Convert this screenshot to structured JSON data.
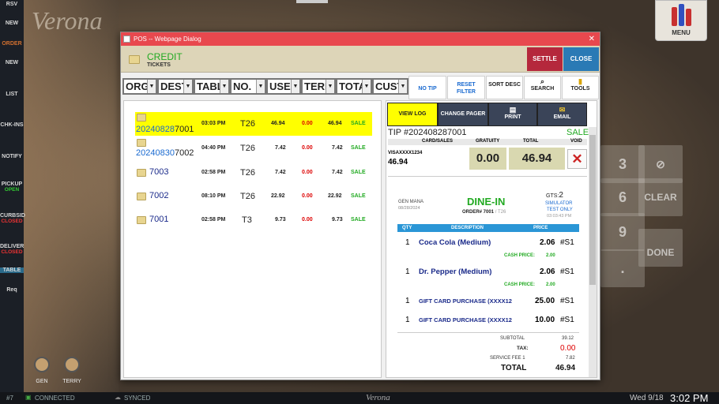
{
  "left_nav": [
    {
      "label": "RSV"
    },
    {
      "label": "NEW"
    },
    {
      "label": "ORDER"
    },
    {
      "label": "NEW"
    },
    {
      "label": "LIST"
    },
    {
      "label": "CHK-INS"
    },
    {
      "label": "NOTIFY"
    },
    {
      "label": "PICKUP",
      "sub": "OPEN"
    },
    {
      "label": "CURBSID",
      "sub": "CLOSED"
    },
    {
      "label": "DELIVER",
      "sub": "CLOSED"
    },
    {
      "label": "TABLE"
    },
    {
      "label": "Req"
    }
  ],
  "background": {
    "logo": "Verona",
    "menu_label": "MENU",
    "keypad": [
      "3",
      "6",
      "CLEAR",
      "9",
      ".",
      "DONE"
    ]
  },
  "staff": [
    "GEN",
    "TERRY"
  ],
  "bottom": {
    "station": "#7",
    "connected": "CONNECTED",
    "synced": "SYNCED",
    "brand": "Verona",
    "date": "Wed 9/18",
    "time": "3:02 PM"
  },
  "dialog": {
    "title": "POS -- Webpage Dialog",
    "close_glyph": "✕",
    "header_title": "CREDIT",
    "header_subtitle": "TICKETS",
    "settle": "SETTLE",
    "close": "CLOSE",
    "filters": [
      "ORG",
      "DEST",
      "TABL",
      "NO.",
      "USER",
      "TERM",
      "TOTA",
      "CUST"
    ],
    "no_tip": "NO TIP",
    "reset_filter": "RESET FILTER",
    "sort_desc": "SORT DESC",
    "search": "SEARCH",
    "tools": "TOOLS",
    "tickets": [
      {
        "id_prefix": "20240828",
        "id_suffix": "7001",
        "time": "03:03 PM",
        "table": "T26",
        "amount": "46.94",
        "tip": "0.00",
        "total": "46.94",
        "status": "SALE",
        "selected": true
      },
      {
        "id_prefix": "20240830",
        "id_suffix": "7002",
        "time": "04:40 PM",
        "table": "T26",
        "amount": "7.42",
        "tip": "0.00",
        "total": "7.42",
        "status": "SALE",
        "selected": false
      },
      {
        "id_prefix": "",
        "id_suffix": "7003",
        "time": "02:58 PM",
        "table": "T26",
        "amount": "7.42",
        "tip": "0.00",
        "total": "7.42",
        "status": "SALE",
        "selected": false
      },
      {
        "id_prefix": "",
        "id_suffix": "7002",
        "time": "08:10 PM",
        "table": "T26",
        "amount": "22.92",
        "tip": "0.00",
        "total": "22.92",
        "status": "SALE",
        "selected": false
      },
      {
        "id_prefix": "",
        "id_suffix": "7001",
        "time": "02:58 PM",
        "table": "T3",
        "amount": "9.73",
        "tip": "0.00",
        "total": "9.73",
        "status": "SALE",
        "selected": false
      }
    ],
    "right": {
      "view_log": "VIEW LOG",
      "change_pager": "CHANGE PAGER",
      "print": "PRINT",
      "email": "EMAIL",
      "tip_line": "TIP #202408287001",
      "sale": "SALE",
      "card_hdr": "CARD/SALES",
      "grat_hdr": "GRATUITY",
      "total_hdr": "TOTAL",
      "void_hdr": "VOID",
      "card": "VISAXXXX1234",
      "card_amount": "46.94",
      "gratuity": "0.00",
      "total": "46.94",
      "receipt": {
        "server": "GEN MANA",
        "date": "08/28/2024",
        "order_type": "DINE-IN",
        "order": "ORDER# 7001",
        "table": "T26",
        "gts_label": "GTS:",
        "gts": "2",
        "sim": "SIMULATOR",
        "test": "TEST ONLY",
        "rtime": "03:03:43 PM",
        "cols": [
          "QTY",
          "DESCRIPTION",
          "PRICE"
        ],
        "items": [
          {
            "qty": "1",
            "desc": "Coca Cola (Medium)",
            "price": "2.06",
            "seat": "#S1",
            "cash_label": "CASH PRICE:",
            "cash": "2.00"
          },
          {
            "qty": "1",
            "desc": "Dr. Pepper (Medium)",
            "price": "2.06",
            "seat": "#S1",
            "cash_label": "CASH PRICE:",
            "cash": "2.00"
          },
          {
            "qty": "1",
            "desc": "GIFT CARD PURCHASE (XXXX12",
            "price": "25.00",
            "seat": "#S1"
          },
          {
            "qty": "1",
            "desc": "GIFT CARD PURCHASE (XXXX12",
            "price": "10.00",
            "seat": "#S1"
          }
        ],
        "subtotal_label": "SUBTOTAL",
        "subtotal": "39.12",
        "tax_label": "TAX:",
        "tax": "0.00",
        "fee_label": "SERVICE FEE 1",
        "fee": "7.82",
        "total_label": "TOTAL",
        "total": "46.94"
      }
    }
  },
  "colors": {
    "title_red": "#e8484e",
    "settle": "#b5283c",
    "close_btn": "#2a7ab5",
    "sale_green": "#22aa22",
    "highlight": "#ffff00",
    "tip_red": "#dd0000"
  }
}
